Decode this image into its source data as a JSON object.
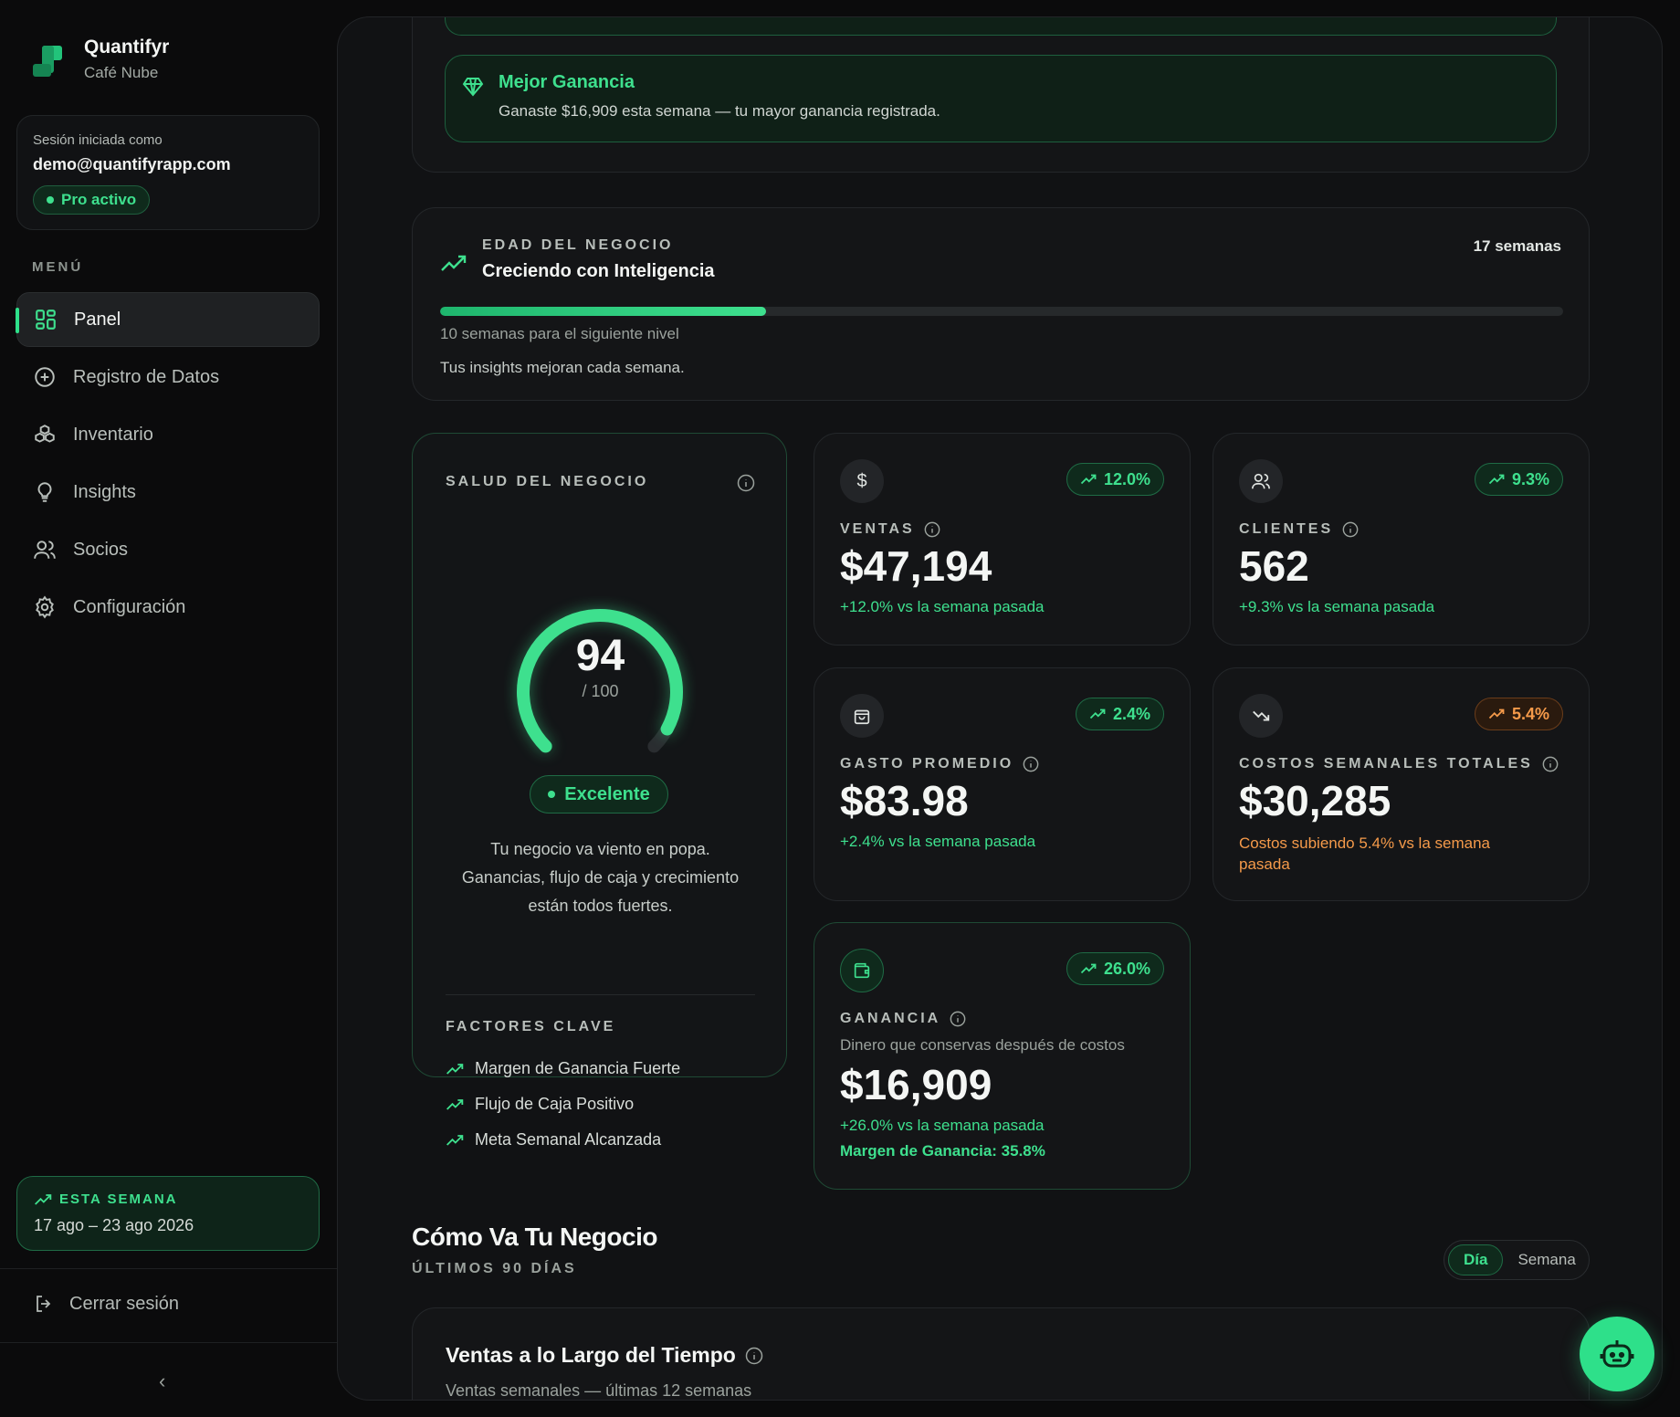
{
  "brand": {
    "name": "Quantifyr",
    "business": "Café Nube"
  },
  "session": {
    "label": "Sesión iniciada como",
    "email": "demo@quantifyrapp.com",
    "plan": "Pro activo"
  },
  "menu": {
    "title": "MENÚ",
    "items": [
      {
        "label": "Panel",
        "icon": "dashboard-grid-icon",
        "active": true
      },
      {
        "label": "Registro de Datos",
        "icon": "plus-circle-icon",
        "active": false
      },
      {
        "label": "Inventario",
        "icon": "boxes-icon",
        "active": false
      },
      {
        "label": "Insights",
        "icon": "lightbulb-icon",
        "active": false
      },
      {
        "label": "Socios",
        "icon": "users-icon",
        "active": false
      },
      {
        "label": "Configuración",
        "icon": "gear-icon",
        "active": false
      }
    ]
  },
  "week": {
    "title": "ESTA SEMANA",
    "dates": "17 ago – 23 ago 2026"
  },
  "logout": {
    "label": "Cerrar sesión"
  },
  "collapse": {
    "label": "‹"
  },
  "best": {
    "title": "Mejor Ganancia",
    "text": "Ganaste $16,909 esta semana — tu mayor ganancia registrada."
  },
  "age": {
    "label": "EDAD DEL NEGOCIO",
    "title": "Creciendo con Inteligencia",
    "weeks": "17 semanas",
    "progress_percent": 29,
    "next": "10 semanas para el siguiente nivel",
    "note": "Tus insights mejoran cada semana."
  },
  "health": {
    "label": "SALUD DEL NEGOCIO",
    "score": "94",
    "score_value": 94,
    "max": "/ 100",
    "status": "Excelente",
    "description": "Tu negocio va viento en popa. Ganancias, flujo de caja y crecimiento están todos fuertes.",
    "factors_label": "FACTORES CLAVE",
    "factors": [
      "Margen de Ganancia Fuerte",
      "Flujo de Caja Positivo",
      "Meta Semanal Alcanzada"
    ]
  },
  "metrics": {
    "ventas": {
      "label": "VENTAS",
      "value": "$47,194",
      "badge": "12.0%",
      "sub": "+12.0% vs la semana pasada"
    },
    "clientes": {
      "label": "CLIENTES",
      "value": "562",
      "badge": "9.3%",
      "sub": "+9.3% vs la semana pasada"
    },
    "gasto": {
      "label": "GASTO PROMEDIO",
      "value": "$83.98",
      "badge": "2.4%",
      "sub": "+2.4% vs la semana pasada"
    },
    "costos": {
      "label": "COSTOS SEMANALES TOTALES",
      "value": "$30,285",
      "badge": "5.4%",
      "sub": "Costos subiendo 5.4% vs la semana pasada"
    },
    "ganancia": {
      "label": "GANANCIA",
      "desc": "Dinero que conservas después de costos",
      "value": "$16,909",
      "badge": "26.0%",
      "sub": "+26.0% vs la semana pasada",
      "margin": "Margen de Ganancia: 35.8%"
    }
  },
  "section": {
    "title": "Cómo Va Tu Negocio",
    "subtitle": "ÚLTIMOS 90 DÍAS",
    "toggle": [
      "Día",
      "Semana"
    ]
  },
  "chart_card": {
    "title": "Ventas a lo Largo del Tiempo",
    "subtitle": "Ventas semanales — últimas 12 semanas"
  },
  "colors": {
    "accent": "#2ee08a",
    "warning": "#f59a4a",
    "background": "#0b0b0c"
  }
}
